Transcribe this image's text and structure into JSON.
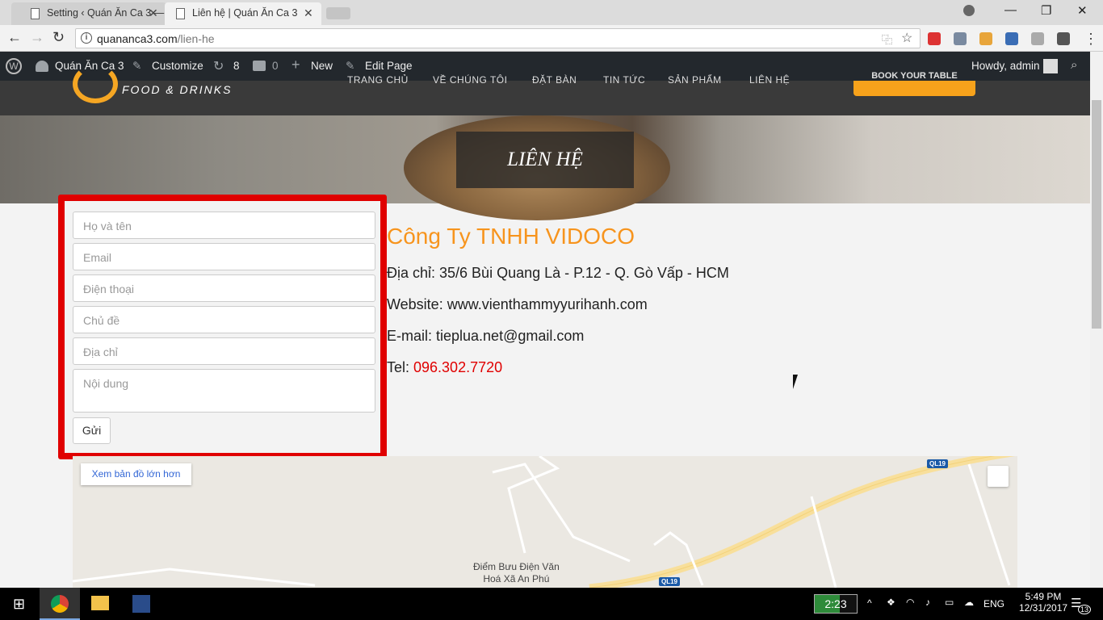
{
  "browser": {
    "tabs": [
      {
        "label": "Setting ‹ Quán Ăn Ca 3 —",
        "active": false
      },
      {
        "label": "Liên hệ | Quán Ăn Ca 3",
        "active": true
      }
    ],
    "url_host": "quananca3.com",
    "url_path": "/lien-he"
  },
  "admin_bar": {
    "site_name": "Quán Ăn Ca 3",
    "customize": "Customize",
    "updates_count": "8",
    "comments_count": "0",
    "new": "New",
    "edit_page": "Edit Page",
    "greeting": "Howdy, admin"
  },
  "site": {
    "logo_text": "FOOD & DRINKS",
    "menu": [
      "TRANG CHỦ",
      "VỀ CHÚNG TÔI",
      "ĐẶT BÀN",
      "TIN TỨC",
      "SẢN PHẨM",
      "LIÊN HỆ"
    ],
    "book_button": "BOOK YOUR TABLE",
    "page_title": "LIÊN HỆ"
  },
  "form": {
    "name_placeholder": "Họ và tên",
    "email_placeholder": "Email",
    "phone_placeholder": "Điện thoại",
    "subject_placeholder": "Chủ đề",
    "address_placeholder": "Địa chỉ",
    "message_placeholder": "Nội dung",
    "submit": "Gửi"
  },
  "company": {
    "name": "Công Ty TNHH VIDOCO",
    "address": "Địa chỉ: 35/6 Bùi Quang Là - P.12 - Q. Gò Vấp - HCM",
    "website": "Website: www.vienthammyyurihanh.com",
    "email": "E-mail: tieplua.net@gmail.com",
    "tel_label": "Tel: ",
    "tel": "096.302.7720"
  },
  "map": {
    "larger_map": "Xem bản đồ lớn hơn",
    "road_label": "QL19",
    "poi_line1": "Điểm Bưu Điện Văn",
    "poi_line2": "Hoá Xã An Phú"
  },
  "taskbar": {
    "battery_time": "2:23",
    "lang": "ENG",
    "time": "5:49 PM",
    "date": "12/31/2017",
    "notifications": "13"
  },
  "colors": {
    "accent": "#f7941d",
    "highlight_border": "#e00000",
    "admin_bar": "#23282d"
  }
}
